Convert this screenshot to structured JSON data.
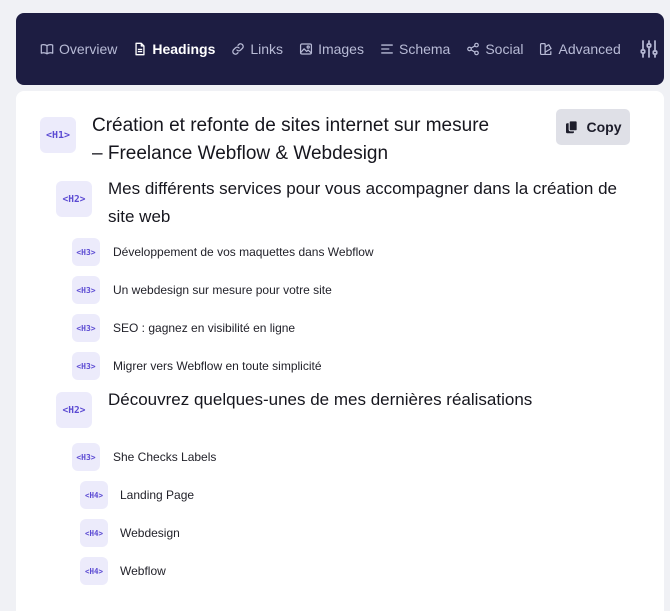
{
  "nav": {
    "tabs": [
      {
        "label": "Overview",
        "icon": "book-open-icon"
      },
      {
        "label": "Headings",
        "icon": "document-icon",
        "active": true
      },
      {
        "label": "Links",
        "icon": "link-icon"
      },
      {
        "label": "Images",
        "icon": "image-icon"
      },
      {
        "label": "Schema",
        "icon": "align-left-icon"
      },
      {
        "label": "Social",
        "icon": "share-icon"
      },
      {
        "label": "Advanced",
        "icon": "advanced-icon"
      }
    ],
    "settings_icon": "sliders-icon"
  },
  "copy_button": {
    "label": "Copy",
    "icon": "clipboard-icon"
  },
  "headings": [
    {
      "level": "<H1>",
      "text": "Création et refonte de sites internet sur mesure – Freelance Webflow & Webdesign"
    },
    {
      "level": "<H2>",
      "text": "Mes différents services pour vous accompagner dans la création de site web"
    },
    {
      "level": "<H3>",
      "text": "Développement de vos maquettes dans Webflow"
    },
    {
      "level": "<H3>",
      "text": "Un webdesign sur mesure pour votre site"
    },
    {
      "level": "<H3>",
      "text": "SEO : gagnez en visibilité en ligne"
    },
    {
      "level": "<H3>",
      "text": "Migrer vers Webflow en toute simplicité"
    },
    {
      "level": "<H2>",
      "text": "Découvrez quelques-unes de mes dernières réalisations"
    },
    {
      "level": "<H3>",
      "text": "She Checks Labels"
    },
    {
      "level": "<H4>",
      "text": "Landing Page"
    },
    {
      "level": "<H4>",
      "text": "Webdesign"
    },
    {
      "level": "<H4>",
      "text": "Webflow"
    }
  ],
  "colors": {
    "nav_bg": "#1d1d42",
    "badge_bg": "#ecebfb",
    "badge_text": "#5c4bd3",
    "copy_bg": "#dfe0e7"
  }
}
